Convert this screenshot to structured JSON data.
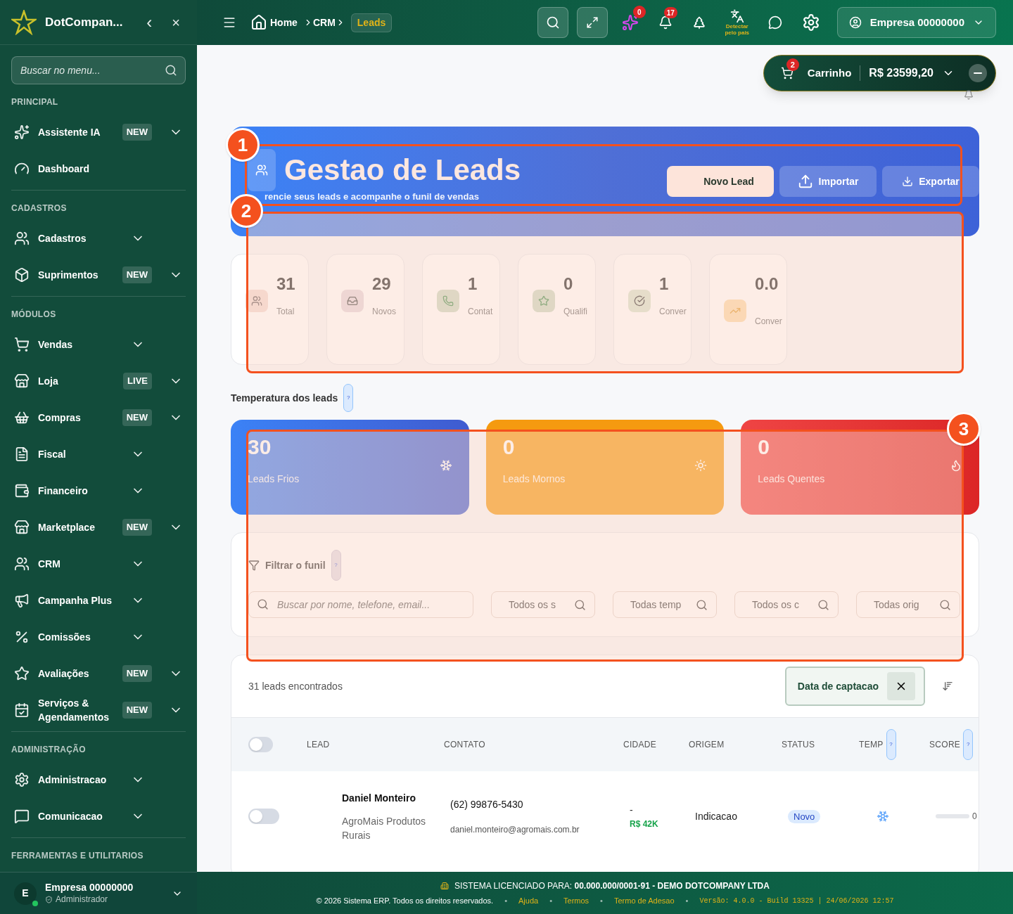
{
  "sidebar": {
    "brand": "DotCompan...",
    "collapse": "‹",
    "close": "×",
    "search": {
      "placeholder": "Buscar no menu..."
    },
    "sections": [
      {
        "title": "PRINCIPAL",
        "items": [
          {
            "label": "Assistente IA",
            "badge": "NEW",
            "expandable": true
          },
          {
            "label": "Dashboard",
            "expandable": false
          }
        ]
      },
      {
        "title": "CADASTROS",
        "items": [
          {
            "label": "Cadastros",
            "expandable": true
          },
          {
            "label": "Suprimentos",
            "badge": "NEW",
            "expandable": true
          }
        ]
      },
      {
        "title": "MÓDULOS",
        "items": [
          {
            "label": "Vendas",
            "expandable": true
          },
          {
            "label": "Loja",
            "badge": "LIVE",
            "expandable": true
          },
          {
            "label": "Compras",
            "badge": "NEW",
            "expandable": true
          },
          {
            "label": "Fiscal",
            "expandable": true
          },
          {
            "label": "Financeiro",
            "expandable": true
          },
          {
            "label": "Marketplace",
            "badge": "NEW",
            "expandable": true
          },
          {
            "label": "CRM",
            "expandable": true
          },
          {
            "label": "Campanha Plus",
            "expandable": true
          },
          {
            "label": "Comissões",
            "expandable": true
          },
          {
            "label": "Avaliações",
            "badge": "NEW",
            "expandable": true
          },
          {
            "label": "Serviços & Agendamentos",
            "badge": "NEW",
            "expandable": true
          }
        ]
      },
      {
        "title": "ADMINISTRAÇÃO",
        "items": [
          {
            "label": "Administracao",
            "expandable": true
          },
          {
            "label": "Comunicacao",
            "expandable": true
          }
        ]
      },
      {
        "title": "FERRAMENTAS E UTILITARIOS"
      }
    ],
    "user": {
      "initial": "E",
      "name": "Empresa 00000000",
      "role": "Administrador"
    }
  },
  "topbar": {
    "breadcrumb": [
      "Home",
      "CRM"
    ],
    "current": "Leads",
    "ai_badge": "0",
    "notifications_badge": "17",
    "translate_label": "Detectar pelo pais",
    "account": "Empresa 00000000"
  },
  "cart": {
    "count": "2",
    "label": "Carrinho",
    "total": "R$ 23599,20"
  },
  "header": {
    "title": "Gestao de Leads",
    "subtitle": "rencie seus leads e acompanhe o funil de vendas",
    "buttons": [
      {
        "label": "Novo Lead",
        "kind": "primary"
      },
      {
        "label": "Importar",
        "kind": "import"
      },
      {
        "label": "Exportar",
        "kind": "export"
      }
    ]
  },
  "stats": [
    {
      "value": "31",
      "label": "Total",
      "kind": "total"
    },
    {
      "value": "29",
      "label": "Novos",
      "kind": "new"
    },
    {
      "value": "1",
      "label": "Contat",
      "kind": "contact"
    },
    {
      "value": "0",
      "label": "Qualifi",
      "kind": "qualified"
    },
    {
      "value": "1",
      "label": "Conver",
      "kind": "converted"
    },
    {
      "value": "0.0",
      "label": "Conver",
      "kind": "rate"
    }
  ],
  "temperature": {
    "title": "Temperatura dos leads",
    "help": "?",
    "cards": [
      {
        "value": "30",
        "label": "Leads Frios",
        "kind": "cold"
      },
      {
        "value": "0",
        "label": "Leads Mornos",
        "kind": "warm"
      },
      {
        "value": "0",
        "label": "Leads Quentes",
        "kind": "hot"
      }
    ]
  },
  "filter": {
    "title": "Filtrar o funil",
    "help": "?",
    "search": {
      "placeholder": "Buscar por nome, telefone, email..."
    },
    "selects": [
      "Todos os s",
      "Todas temp",
      "Todos os c",
      "Todas orig"
    ]
  },
  "results": {
    "count": "31 leads encontrados",
    "sort_chip": "Data de captacao"
  },
  "table": {
    "select_all": {
      "checked": false
    },
    "columns": [
      {
        "label": "LEAD"
      },
      {
        "label": "CONTATO"
      },
      {
        "label": "CIDADE"
      },
      {
        "label": "ORIGEM"
      },
      {
        "label": "STATUS"
      },
      {
        "label": "TEMP",
        "help": "?"
      },
      {
        "label": "SCORE",
        "help": "?"
      }
    ],
    "rows": [
      {
        "checked": false,
        "name": "Daniel Monteiro",
        "company": "AgroMais Produtos Rurais",
        "phone": "(62) 99876-5430",
        "email": "daniel.monteiro@agromais.com.br",
        "city": "-",
        "value": "R$ 42K",
        "origin": "Indicacao",
        "status": "Novo",
        "temperature": {
          "kind": "cold"
        },
        "score": {
          "level": 0,
          "text": "0"
        }
      }
    ]
  },
  "tour": [
    "1",
    "2",
    "3"
  ],
  "status_bar": {
    "license": "SISTEMA LICENCIADO PARA: **00.000.000/0001-91 - DEMO DOTCOMPANY LTDA**",
    "copyright": "© 2026 Sistema ERP. Todos os direitos reservados.",
    "links": [
      "Ajuda",
      "Termos",
      "Termo de Adesao"
    ],
    "separator": "•",
    "version": "Versão: 4.0.0 - Build 13325 | 24/06/2026 12:57"
  }
}
